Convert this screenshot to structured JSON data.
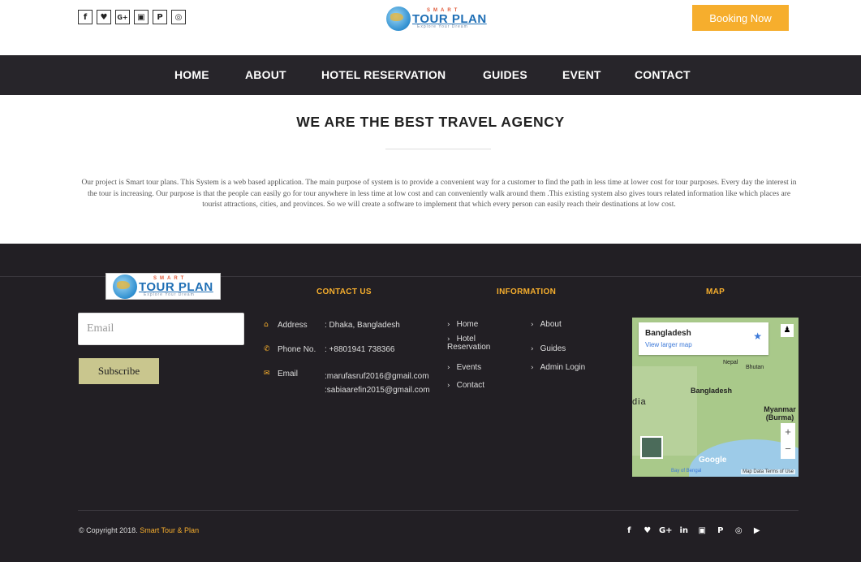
{
  "header": {
    "social_icons": [
      {
        "name": "facebook-icon",
        "glyph": "f"
      },
      {
        "name": "twitter-icon",
        "glyph": "♥"
      },
      {
        "name": "google-plus-icon",
        "glyph": "G+"
      },
      {
        "name": "instagram-icon",
        "glyph": "▣"
      },
      {
        "name": "pinterest-icon",
        "glyph": "P"
      },
      {
        "name": "circle-icon",
        "glyph": "◎"
      }
    ],
    "logo": {
      "small": "SMART",
      "big": "TOUR PLAN",
      "tag": "Explore Your Dream"
    },
    "booking_label": "Booking Now",
    "colors": {
      "accent": "#f6ae2d",
      "nav_bg": "#27252a",
      "footer_bg": "#221f24"
    }
  },
  "nav": {
    "items": [
      "HOME",
      "ABOUT",
      "HOTEL RESERVATION",
      "GUIDES",
      "EVENT",
      "CONTACT"
    ]
  },
  "hero": {
    "headline": "WE ARE THE BEST TRAVEL AGENCY",
    "about_text": "Our project is Smart tour plans. This System is a web based application. The main purpose of system is to provide a convenient way for a customer to find the path in less time at lower cost for tour purposes. Every day the interest in the tour is increasing. Our purpose is that the people can easily go for tour anywhere in less time at low cost and can conveniently walk around them .This existing system also gives tours related information like which places are tourist attractions, cities, and provinces. So we will create a software to implement that which every person can easily reach their destinations at low cost."
  },
  "footer": {
    "logo": {
      "small": "SMART",
      "big": "TOUR PLAN",
      "tag": "Explore Your Dream"
    },
    "email_placeholder": "Email",
    "subscribe_label": "Subscribe",
    "contact_title": "CONTACT US",
    "contact": {
      "address_label": "Address",
      "address_value": ": Dhaka, Bangladesh",
      "phone_label": "Phone No.",
      "phone_value": ": +8801941 738366",
      "email_label": "Email",
      "email_value_1": ":marufasruf2016@gmail.com",
      "email_value_2": ":sabiaarefin2015@gmail.com"
    },
    "info_title": "INFORMATION",
    "info_links_left": [
      "Home",
      "Hotel Reservation",
      "Events",
      "Contact"
    ],
    "info_links_right": [
      "About",
      "Guides",
      "Admin Login"
    ],
    "map_title": "MAP",
    "map": {
      "place": "Bangladesh",
      "link": "View larger map",
      "label_nepal": "Nepal",
      "label_bhutan": "Bhutan",
      "label_bangladesh": "Bangladesh",
      "label_india": "dia",
      "label_myanmar": "Myanmar (Burma)",
      "label_bay": "Bay of Bengal",
      "google": "Google",
      "map_data": "Map Data   Terms of Use"
    },
    "copyright_prefix": "© Copyright 2018.",
    "copyright_brand": "Smart Tour & Plan",
    "social_icons": [
      {
        "name": "facebook-icon",
        "glyph": "f"
      },
      {
        "name": "twitter-icon",
        "glyph": "♥"
      },
      {
        "name": "google-plus-icon",
        "glyph": "G+"
      },
      {
        "name": "linkedin-icon",
        "glyph": "in"
      },
      {
        "name": "instagram-icon",
        "glyph": "▣"
      },
      {
        "name": "pinterest-icon",
        "glyph": "P"
      },
      {
        "name": "circle-icon",
        "glyph": "◎"
      },
      {
        "name": "youtube-icon",
        "glyph": "▶"
      }
    ]
  }
}
